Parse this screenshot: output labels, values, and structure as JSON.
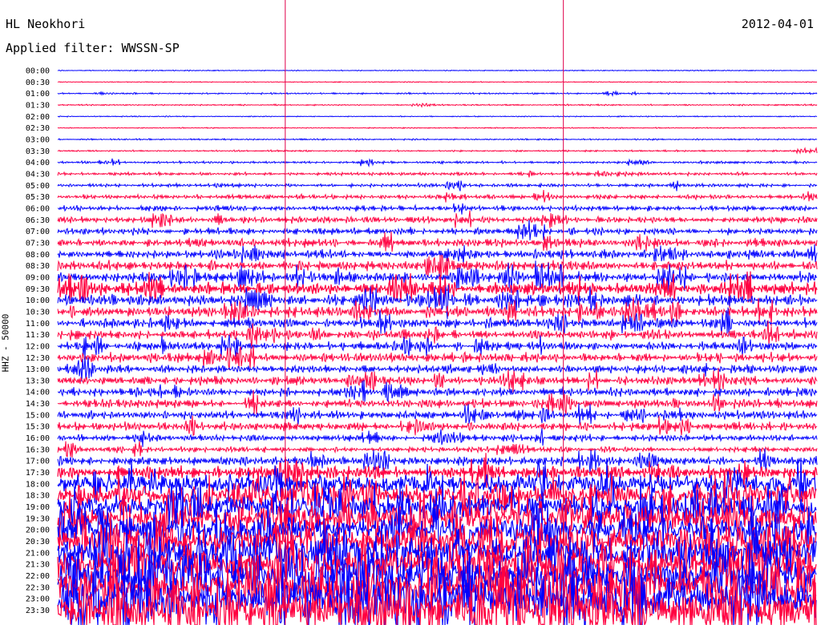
{
  "header": {
    "station": "HL Neokhori",
    "date": "2012-04-01",
    "filter_prefix": "Applied filter:",
    "filter_name": "WWSSN-SP"
  },
  "channel_label": "HHZ - 50000",
  "chart_data": {
    "type": "line",
    "title": "HL Neokhori",
    "xlabel": "",
    "ylabel": "HHZ - 50000",
    "line_start_times": [
      "00:00",
      "00:30",
      "01:00",
      "01:30",
      "02:00",
      "02:30",
      "03:00",
      "03:30",
      "04:00",
      "04:30",
      "05:00",
      "05:30",
      "06:00",
      "06:30",
      "07:00",
      "07:30",
      "08:00",
      "08:30",
      "09:00",
      "09:30",
      "10:00",
      "10:30",
      "11:00",
      "11:30",
      "12:00",
      "12:30",
      "13:00",
      "13:30",
      "14:00",
      "14:30",
      "15:00",
      "15:30",
      "16:00",
      "16:30",
      "17:00",
      "17:30",
      "18:00",
      "18:30",
      "19:00",
      "19:30",
      "20:00",
      "20:30",
      "21:00",
      "21:30",
      "22:00",
      "22:30",
      "23:00",
      "23:30"
    ],
    "line_duration_minutes": 30,
    "trace_colors": [
      "#0000ff",
      "#ff0040"
    ],
    "event_marker_color": "#e0004a",
    "event_marker_minutes": [
      9,
      20
    ],
    "relative_amplitude_per_line": [
      0.08,
      0.08,
      0.14,
      0.12,
      0.09,
      0.09,
      0.12,
      0.14,
      0.22,
      0.26,
      0.3,
      0.38,
      0.45,
      0.55,
      0.6,
      0.7,
      0.72,
      0.8,
      0.95,
      1.05,
      1.0,
      0.95,
      0.85,
      0.8,
      0.75,
      0.78,
      0.7,
      0.72,
      0.7,
      0.75,
      0.68,
      0.7,
      0.55,
      0.5,
      0.75,
      1.1,
      1.4,
      1.6,
      1.7,
      1.8,
      1.9,
      2.0,
      2.1,
      2.2,
      2.3,
      2.4,
      2.6,
      2.8
    ]
  }
}
